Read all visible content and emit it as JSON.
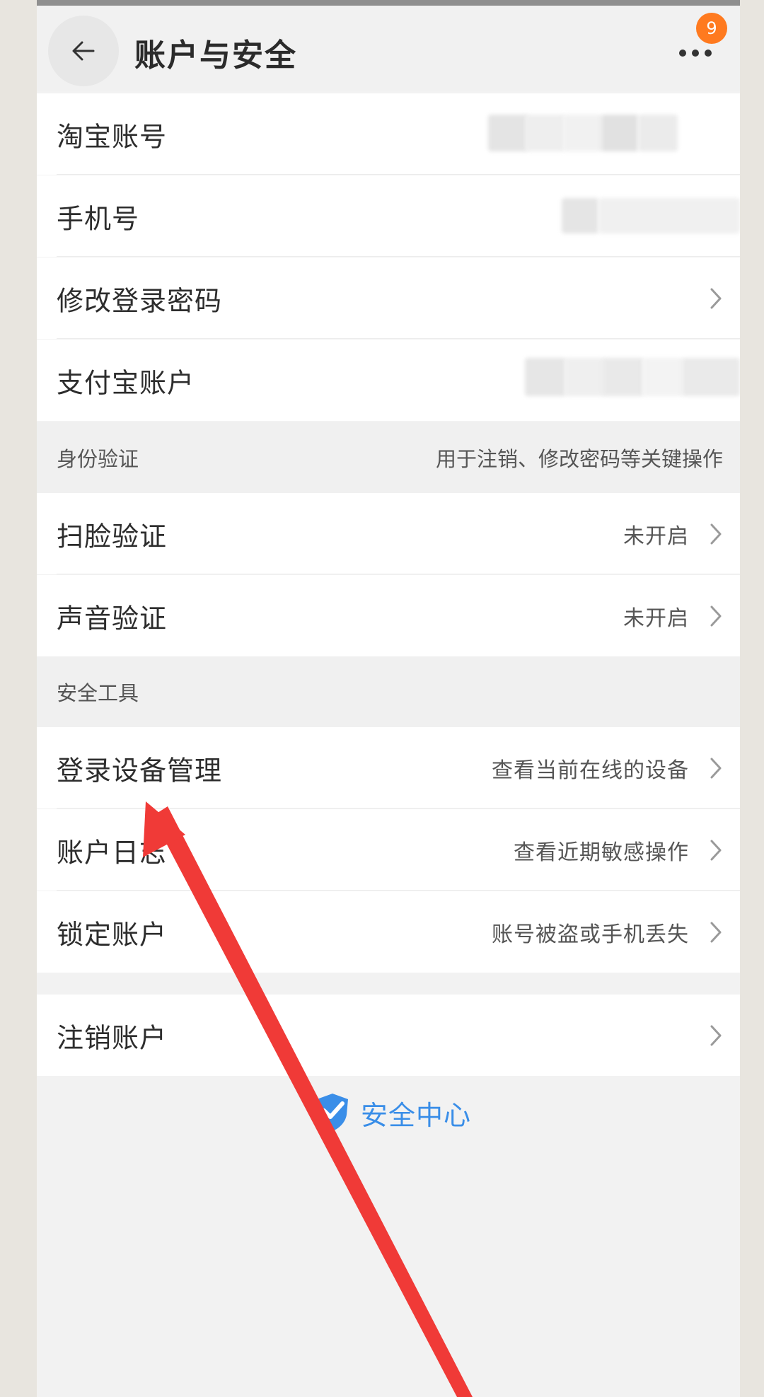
{
  "header": {
    "title": "账户与安全",
    "back_icon": "back-arrow-icon",
    "more_icon": "more-dots-icon",
    "badge_count": "9"
  },
  "account_rows": [
    {
      "label": "淘宝账号",
      "value_redacted": true
    },
    {
      "label": "手机号",
      "value_redacted": true
    },
    {
      "label": "修改登录密码",
      "chevron": true
    },
    {
      "label": "支付宝账户",
      "value_redacted": true
    }
  ],
  "identity_section": {
    "title": "身份验证",
    "description": "用于注销、修改密码等关键操作",
    "rows": [
      {
        "label": "扫脸验证",
        "value": "未开启"
      },
      {
        "label": "声音验证",
        "value": "未开启"
      }
    ]
  },
  "tools_section": {
    "title": "安全工具",
    "rows": [
      {
        "label": "登录设备管理",
        "value": "查看当前在线的设备"
      },
      {
        "label": "账户日志",
        "value": "查看近期敏感操作"
      },
      {
        "label": "锁定账户",
        "value": "账号被盗或手机丢失"
      }
    ]
  },
  "cancel_row": {
    "label": "注销账户"
  },
  "footer": {
    "security_center_label": "安全中心",
    "shield_icon": "shield-check-icon"
  },
  "colors": {
    "accent_blue": "#3a8ee8",
    "badge_orange": "#ff7a1f",
    "annotation_red": "#f03a37",
    "page_bg": "#f2f2f2",
    "row_bg": "#ffffff"
  }
}
